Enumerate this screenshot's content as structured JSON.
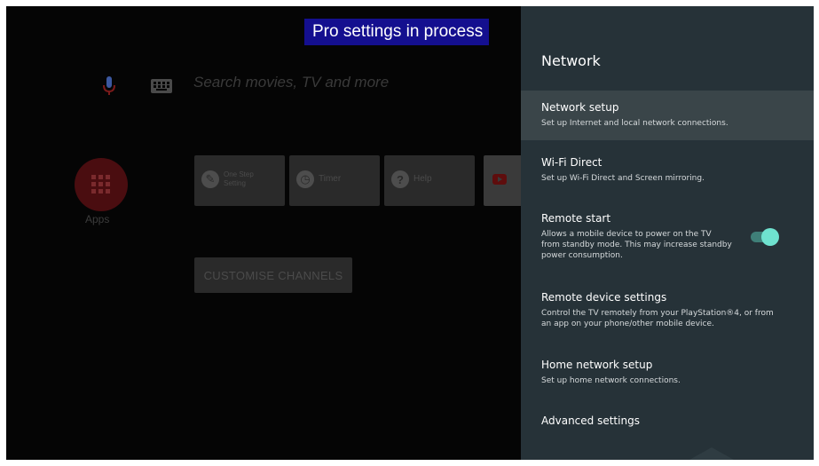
{
  "banner": {
    "text": "Pro settings in process"
  },
  "home": {
    "search_placeholder": "Search movies, TV and more",
    "apps_label": "Apps",
    "cards": [
      {
        "icon": "one-step-setting-icon",
        "label": "One Step Setting"
      },
      {
        "icon": "timer-icon",
        "label": "Timer"
      },
      {
        "icon": "help-icon",
        "label": "Help"
      },
      {
        "icon": "youtube-icon",
        "label": ""
      }
    ],
    "customise_label": "CUSTOMISE CHANNELS"
  },
  "panel": {
    "title": "Network",
    "items": [
      {
        "title": "Network setup",
        "desc": "Set up Internet and local network connections.",
        "selected": true
      },
      {
        "title": "Wi-Fi Direct",
        "desc": "Set up Wi-Fi Direct and Screen mirroring."
      },
      {
        "title": "Remote start",
        "desc_lines": [
          "Allows a mobile device to power on the TV",
          "from standby mode. This may increase standby",
          "power consumption."
        ],
        "toggle_on": true
      },
      {
        "title": "Remote device settings",
        "desc_lines": [
          "Control the TV remotely from your PlayStation®4, or from",
          "an app on your phone/other mobile device."
        ]
      },
      {
        "title": "Home network setup",
        "desc": "Set up home network connections."
      },
      {
        "title": "Advanced settings"
      }
    ]
  },
  "colors": {
    "panel_bg": "#263238",
    "selected_bg": "#3a4549",
    "toggle_knob": "#6fe2cf",
    "banner_bg": "#140f8f"
  }
}
